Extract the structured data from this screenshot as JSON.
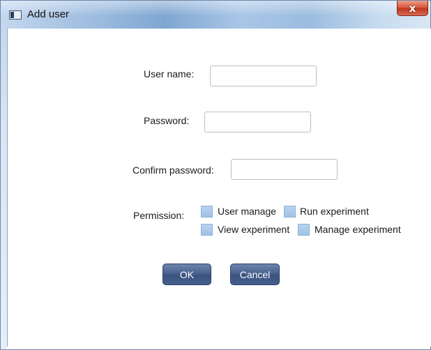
{
  "window": {
    "title": "Add user",
    "close_label": "x"
  },
  "form": {
    "username_label": "User name:",
    "username_value": "",
    "password_label": "Password:",
    "password_value": "",
    "confirm_label": "Confirm password:",
    "confirm_value": "",
    "permission_label": "Permission:",
    "permissions": [
      {
        "label": "User manage",
        "checked": false
      },
      {
        "label": "Run experiment",
        "checked": false
      },
      {
        "label": "View experiment",
        "checked": false
      },
      {
        "label": "Manage experiment",
        "checked": false
      }
    ]
  },
  "buttons": {
    "ok": "OK",
    "cancel": "Cancel"
  }
}
